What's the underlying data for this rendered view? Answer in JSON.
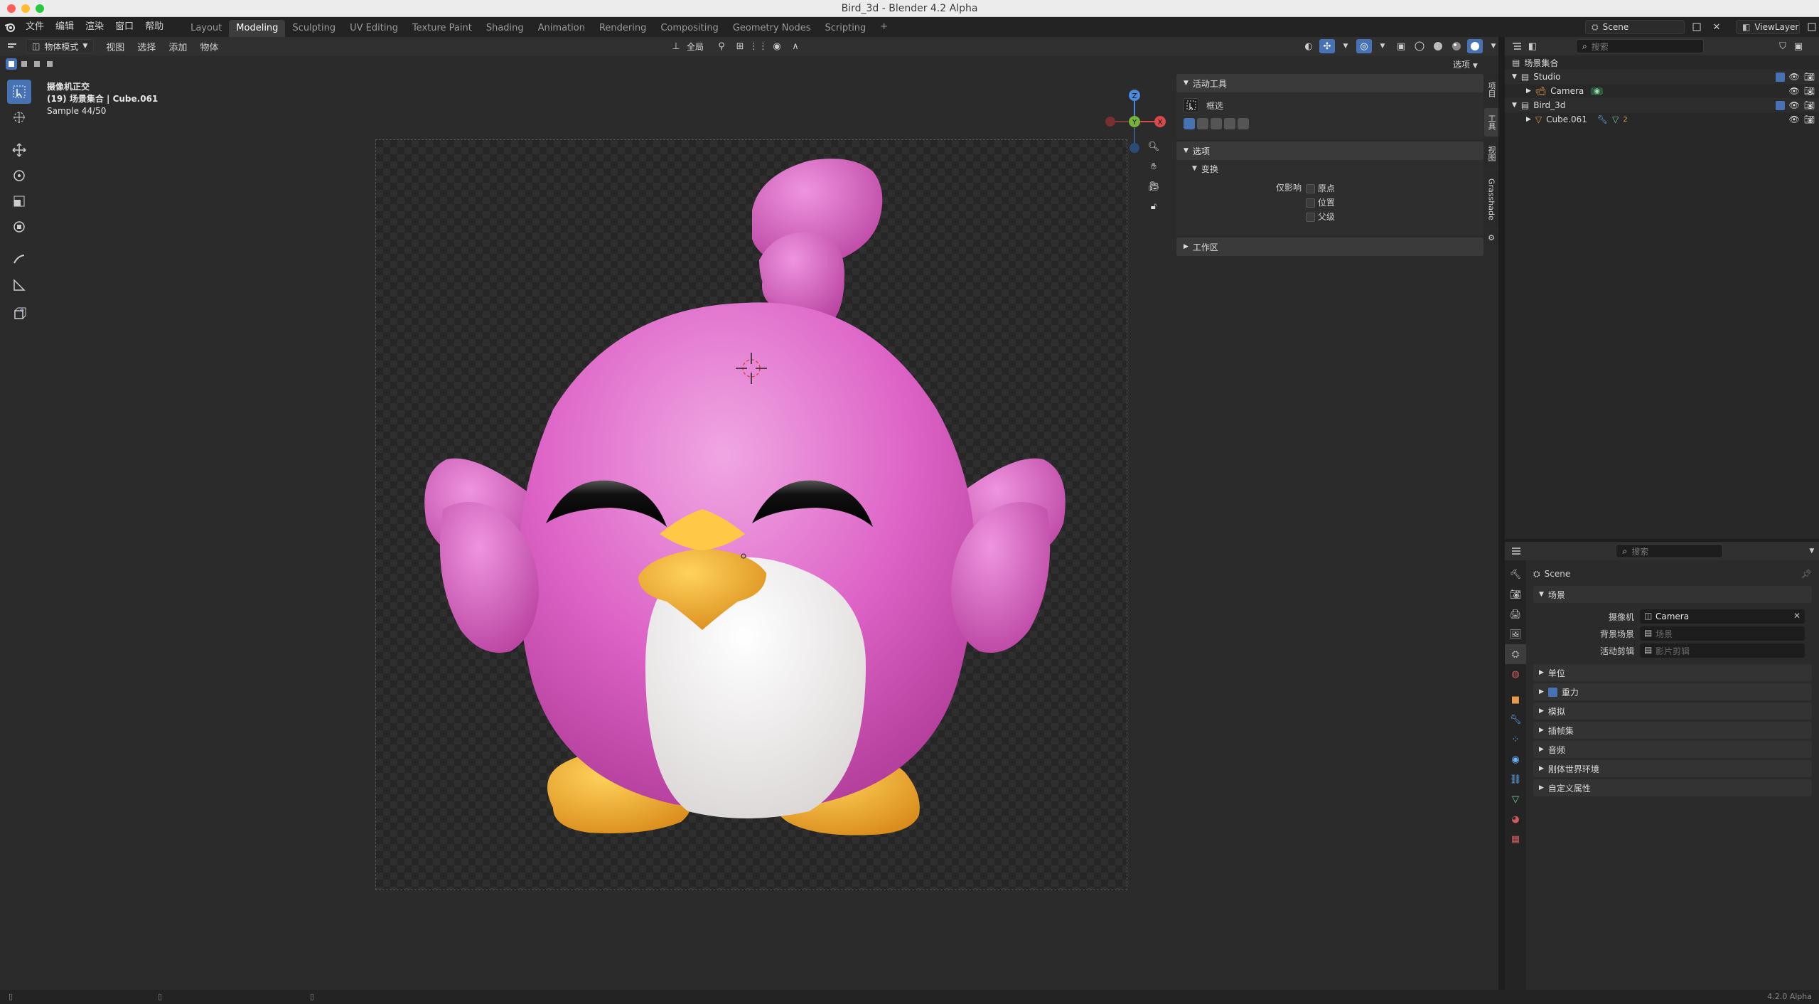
{
  "window": {
    "title": "Bird_3d - Blender 4.2 Alpha"
  },
  "top_menu": [
    "文件",
    "编辑",
    "渲染",
    "窗口",
    "帮助"
  ],
  "workspaces": [
    "Layout",
    "Modeling",
    "Sculpting",
    "UV Editing",
    "Texture Paint",
    "Shading",
    "Animation",
    "Rendering",
    "Compositing",
    "Geometry Nodes",
    "Scripting"
  ],
  "active_workspace": "Modeling",
  "scene_selector": {
    "value": "Scene"
  },
  "viewlayer_selector": {
    "value": "ViewLayer"
  },
  "viewport_header": {
    "mode": "物体模式",
    "menus": [
      "视图",
      "选择",
      "添加",
      "物体"
    ],
    "transform_orientation": "全局",
    "options_label": "选项"
  },
  "viewport_overlay": {
    "line1": "摄像机正交",
    "line2": "(19) 场景集合 | Cube.061",
    "line3": "Sample 44/50"
  },
  "npanel": {
    "active_tool_header": "活动工具",
    "tool_name": "框选",
    "options_header": "选项",
    "transform_header": "变换",
    "affect_only_label": "仅影响",
    "checkboxes": [
      "原点",
      "位置",
      "父级"
    ],
    "workspace_header": "工作区"
  },
  "side_tabs": [
    "项目",
    "工具",
    "视图",
    "Grasshade"
  ],
  "outliner": {
    "search_placeholder": "搜索",
    "root": "场景集合",
    "rows": [
      {
        "name": "Studio",
        "level": 1
      },
      {
        "name": "Camera",
        "level": 2
      },
      {
        "name": "Bird_3d",
        "level": 1
      },
      {
        "name": "Cube.061",
        "level": 2,
        "badge": "2"
      }
    ]
  },
  "properties": {
    "search_placeholder": "搜索",
    "context": "Scene",
    "section_scene": "场景",
    "fields": [
      {
        "label": "摄像机",
        "value": "Camera",
        "placeholder": ""
      },
      {
        "label": "背景场景",
        "value": "",
        "placeholder": "场景"
      },
      {
        "label": "活动剪辑",
        "value": "",
        "placeholder": "影片剪辑"
      }
    ],
    "sections": [
      "单位",
      "重力",
      "模拟",
      "插帧集",
      "音频",
      "刚体世界环境",
      "自定义属性"
    ],
    "gravity_checked": true
  },
  "status": {
    "version": "4.2.0 Alpha"
  },
  "colors": {
    "accent": "#4772b3",
    "bird_pink": "#d95ec4",
    "beak_yellow": "#f0ad2a",
    "belly_white": "#f2f0f0"
  }
}
